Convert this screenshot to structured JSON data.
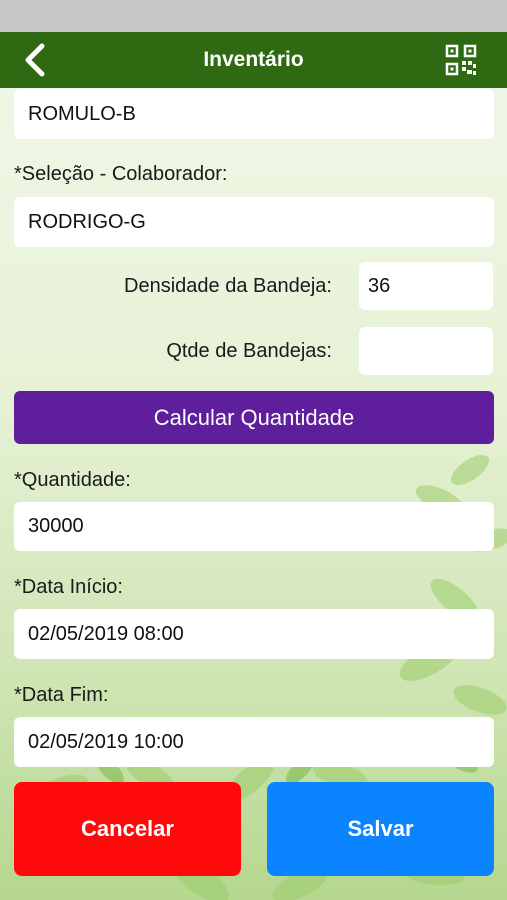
{
  "header": {
    "title": "Inventário",
    "back_icon": "chevron-left-icon",
    "qr_icon": "qr-code-icon"
  },
  "form": {
    "responsible_value": "ROMULO-B",
    "collaborator_label": "*Seleção - Colaborador:",
    "collaborator_value": "RODRIGO-G",
    "tray_density_label": "Densidade da Bandeja:",
    "tray_density_value": "36",
    "tray_count_label": "Qtde de Bandejas:",
    "tray_count_value": "",
    "calculate_button": "Calcular Quantidade",
    "quantity_label": "*Quantidade:",
    "quantity_value": "30000",
    "start_date_label": "*Data Início:",
    "start_date_value": "02/05/2019 08:00",
    "end_date_label": "*Data Fim:",
    "end_date_value": "02/05/2019 10:00"
  },
  "actions": {
    "cancel": "Cancelar",
    "save": "Salvar"
  },
  "colors": {
    "header_bg": "#2f6a12",
    "calculate_bg": "#5f1f9c",
    "cancel_bg": "#ff0a0a",
    "save_bg": "#0a84ff"
  }
}
